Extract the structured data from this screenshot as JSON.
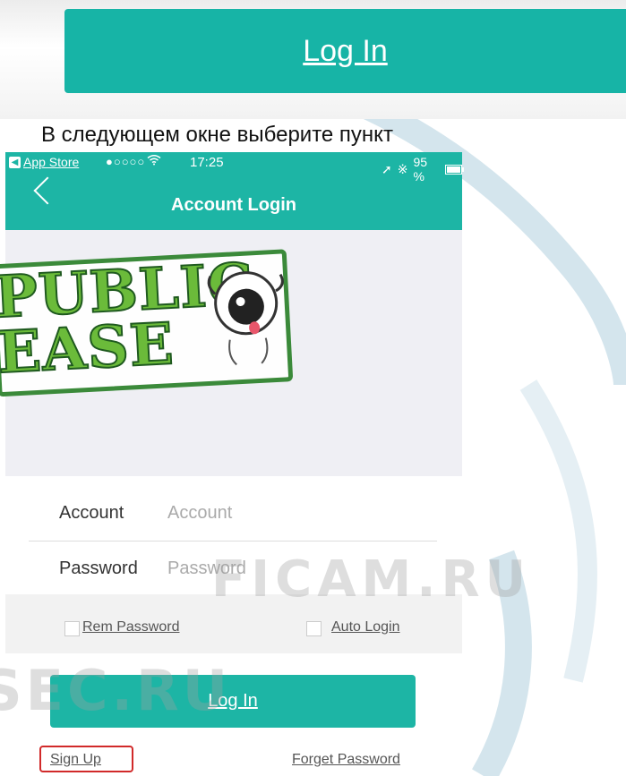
{
  "banner": {
    "login_label": "Log In",
    "instruction": "В следующем окне выберите пункт"
  },
  "status_bar": {
    "back_app": "App Store",
    "signal": "●○○○○",
    "wifi_icon": "wifi-icon",
    "time": "17:25",
    "battery": "95 %",
    "battery_level": 0.95
  },
  "nav": {
    "title": "Account Login"
  },
  "sticker": {
    "line1": "PUBLIC",
    "line2": "EASE"
  },
  "form": {
    "account_label": "Account",
    "account_placeholder": "Account",
    "account_value": "",
    "password_label": "Password",
    "password_placeholder": "Password",
    "password_value": "",
    "rem_password": "Rem Password",
    "auto_login": "Auto Login",
    "login_button": "Log In",
    "sign_up": "Sign Up",
    "forget_password": "Forget Password"
  },
  "watermarks": {
    "ficam": "FICAM.RU",
    "sec": "SEC.RU"
  },
  "colors": {
    "teal": "#1db5a5",
    "highlight": "#d12a2a",
    "sticker_green": "#3b8a3a"
  }
}
